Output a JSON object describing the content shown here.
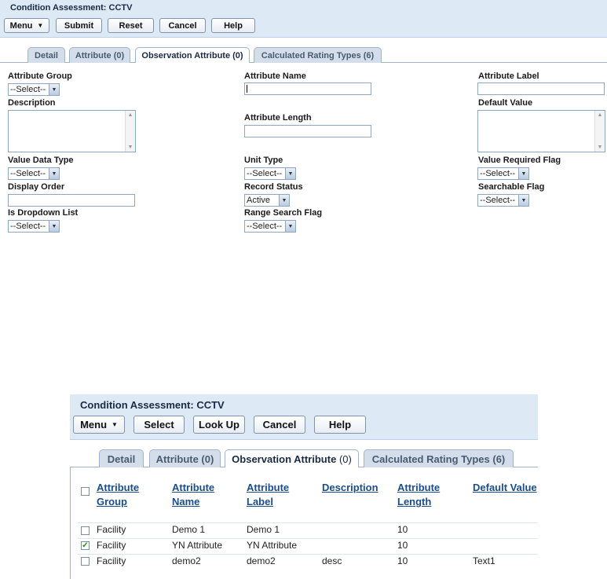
{
  "form": {
    "title": "Condition Assessment: CCTV",
    "buttons": {
      "menu": "Menu",
      "submit": "Submit",
      "reset": "Reset",
      "cancel": "Cancel",
      "help": "Help"
    },
    "tabs": {
      "detail": "Detail",
      "attribute": "Attribute (0)",
      "observation": "Observation Attribute (0)",
      "calculated": "Calculated Rating Types (6)"
    },
    "labels": {
      "attribute_group": "Attribute Group",
      "attribute_name": "Attribute Name",
      "attribute_label": "Attribute Label",
      "description": "Description",
      "default_value": "Default Value",
      "attribute_length": "Attribute Length",
      "value_data_type": "Value Data Type",
      "unit_type": "Unit Type",
      "value_required_flag": "Value Required Flag",
      "display_order": "Display Order",
      "record_status": "Record Status",
      "searchable_flag": "Searchable Flag",
      "is_dropdown_list": "Is Dropdown List",
      "range_search_flag": "Range Search Flag"
    },
    "values": {
      "attribute_group": "--Select--",
      "value_data_type": "--Select--",
      "unit_type": "--Select--",
      "value_required_flag": "--Select--",
      "record_status": "Active",
      "searchable_flag": "--Select--",
      "is_dropdown_list": "--Select--",
      "range_search_flag": "--Select--"
    }
  },
  "list": {
    "title": "Condition Assessment: CCTV",
    "buttons": {
      "menu": "Menu",
      "select": "Select",
      "lookup": "Look Up",
      "cancel": "Cancel",
      "help": "Help"
    },
    "tabs": {
      "detail": "Detail",
      "attribute": "Attribute (0)",
      "observation_label": "Observation Attribute",
      "observation_count": "(0)",
      "calculated": "Calculated Rating Types (6)"
    },
    "columns": {
      "group_1": "Attribute",
      "group_2": "Group",
      "name_1": "Attribute",
      "name_2": "Name",
      "label_1": "Attribute",
      "label_2": "Label",
      "description": "Description",
      "length_1": "Attribute",
      "length_2": "Length",
      "default_value": "Default Value"
    },
    "rows": [
      {
        "checked": false,
        "group": "Facility",
        "name": "Demo 1",
        "label": "Demo 1",
        "description": "",
        "length": "10",
        "default": ""
      },
      {
        "checked": true,
        "group": "Facility",
        "name": "YN Attribute",
        "label": "YN Attribute",
        "description": "",
        "length": "10",
        "default": ""
      },
      {
        "checked": false,
        "group": "Facility",
        "name": "demo2",
        "label": "demo2",
        "description": "desc",
        "length": "10",
        "default": "Text1"
      }
    ]
  },
  "icons": {
    "menu_caret": "caret-down-icon",
    "select_arrow": "chevron-down-icon",
    "checkmark": "check-icon"
  },
  "colors": {
    "header_band": "#dde9f5",
    "link_blue": "#1a4d8a",
    "tab_inactive": "#d3deea"
  }
}
